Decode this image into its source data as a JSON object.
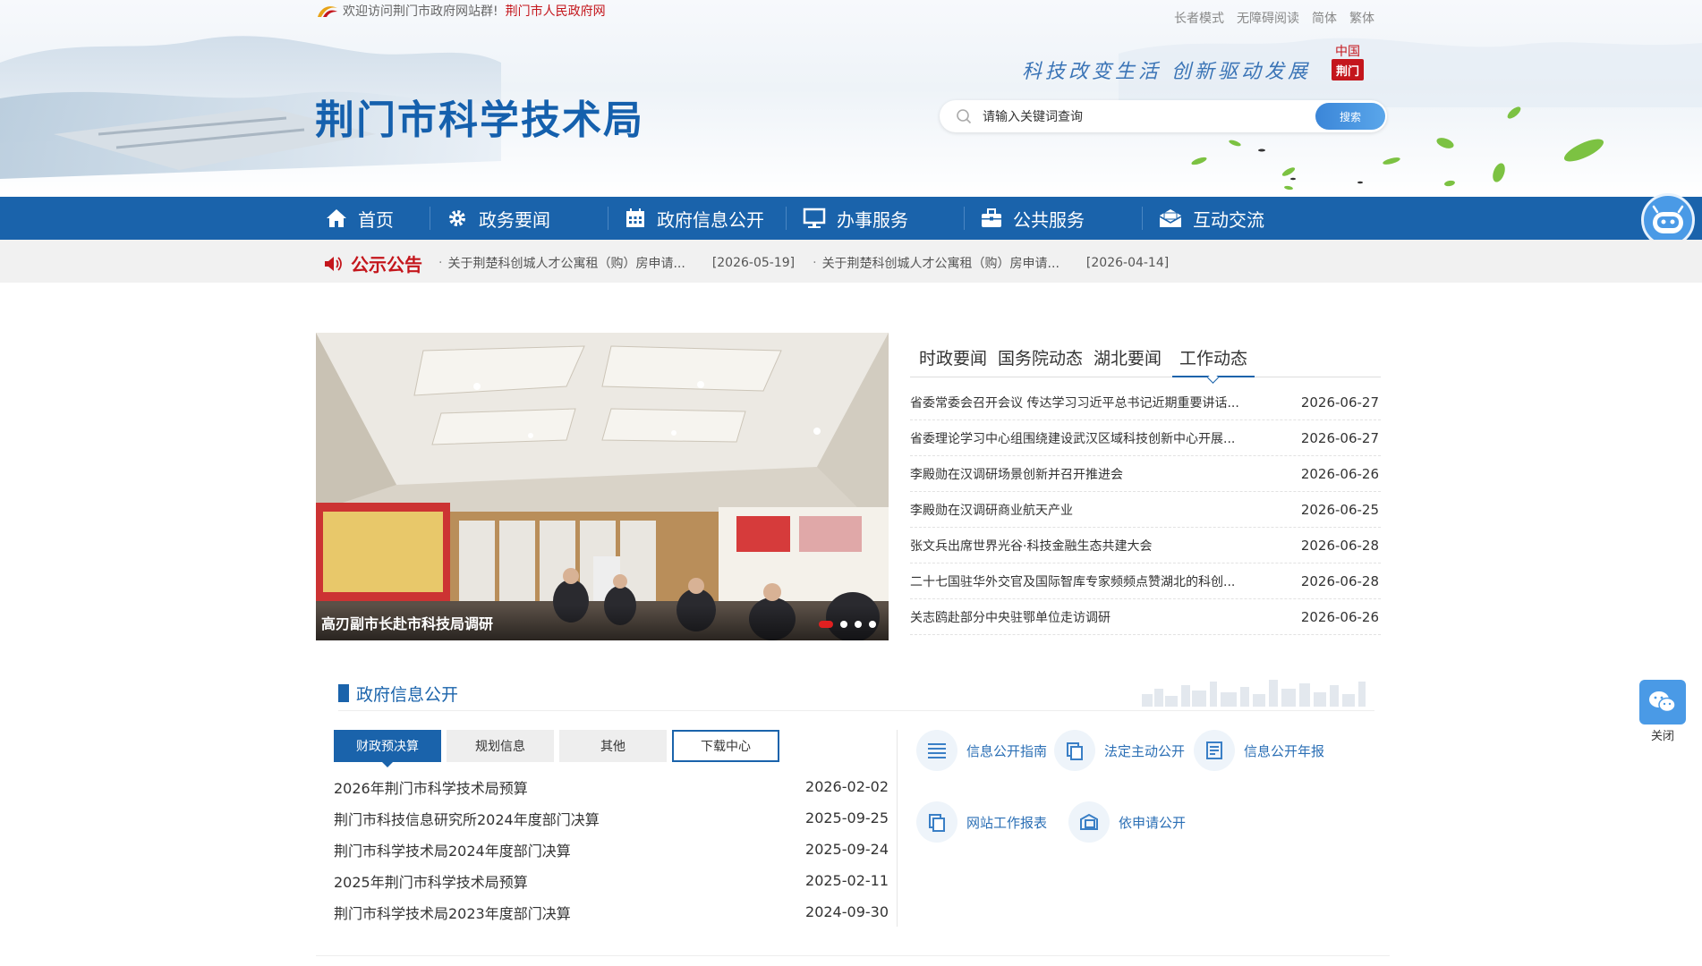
{
  "header": {
    "welcome_text": "欢迎访问荆门市政府网站群!",
    "welcome_link": "荆门市人民政府网",
    "top_links": [
      "长者模式",
      "无障碍阅读",
      "简体",
      "繁体"
    ],
    "site_title": "荆门市科学技术局",
    "slogan": "科技改变生活 创新驱动发展",
    "badge_top": "中国",
    "badge_bottom": "荆门",
    "search": {
      "placeholder": "请输入关键词查询",
      "button": "搜索"
    }
  },
  "nav": {
    "items": [
      {
        "label": "首页",
        "icon": "home-icon"
      },
      {
        "label": "政务要闻",
        "icon": "gear-icon"
      },
      {
        "label": "政府信息公开",
        "icon": "calendar-icon"
      },
      {
        "label": "办事服务",
        "icon": "monitor-icon"
      },
      {
        "label": "公共服务",
        "icon": "briefcase-icon"
      },
      {
        "label": "互动交流",
        "icon": "mail-icon"
      }
    ]
  },
  "notice": {
    "title": "公示公告",
    "items": [
      {
        "text": "关于荆楚科创城人才公寓租（购）房申请...",
        "date": "[2026-05-19]"
      },
      {
        "text": "关于荆楚科创城人才公寓租（购）房申请...",
        "date": "[2026-04-14]"
      }
    ]
  },
  "carousel": {
    "caption": "高刃副市长赴市科技局调研",
    "slides": 4,
    "active": 0
  },
  "news": {
    "tabs": [
      "时政要闻",
      "国务院动态",
      "湖北要闻",
      "工作动态"
    ],
    "active_tab": 3,
    "rows": [
      {
        "title": "省委常委会召开会议 传达学习习近平总书记近期重要讲话...",
        "date": "2026-06-27"
      },
      {
        "title": "省委理论学习中心组围绕建设武汉区域科技创新中心开展...",
        "date": "2026-06-27"
      },
      {
        "title": "李殿勋在汉调研场景创新并召开推进会",
        "date": "2026-06-26"
      },
      {
        "title": "李殿勋在汉调研商业航天产业",
        "date": "2026-06-25"
      },
      {
        "title": "张文兵出席世界光谷·科技金融生态共建大会",
        "date": "2026-06-28"
      },
      {
        "title": "二十七国驻华外交官及国际智库专家频频点赞湖北的科创...",
        "date": "2026-06-28"
      },
      {
        "title": "关志鸥赴部分中央驻鄂单位走访调研",
        "date": "2026-06-26"
      }
    ]
  },
  "gov": {
    "title": "政府信息公开",
    "tabs": [
      "财政预决算",
      "规划信息",
      "其他",
      "下载中心"
    ],
    "rows": [
      {
        "title": "2026年荆门市科学技术局预算",
        "date": "2026-02-02"
      },
      {
        "title": "荆门市科技信息研究所2024年度部门决算",
        "date": "2025-09-25"
      },
      {
        "title": "荆门市科学技术局2024年度部门决算",
        "date": "2025-09-24"
      },
      {
        "title": "2025年荆门市科学技术局预算",
        "date": "2025-02-11"
      },
      {
        "title": "荆门市科学技术局2023年度部门决算",
        "date": "2024-09-30"
      }
    ],
    "links": [
      {
        "label": "信息公开指南",
        "icon": "list-icon"
      },
      {
        "label": "法定主动公开",
        "icon": "copy-icon"
      },
      {
        "label": "信息公开年报",
        "icon": "report-icon"
      },
      {
        "label": "网站工作报表",
        "icon": "copy-icon"
      },
      {
        "label": "依申请公开",
        "icon": "apply-icon"
      }
    ]
  },
  "float": {
    "close_label": "关闭"
  },
  "colors": {
    "primary": "#1a63ab",
    "accent_red": "#c4161c",
    "notice_bg": "#f1f1f1"
  }
}
